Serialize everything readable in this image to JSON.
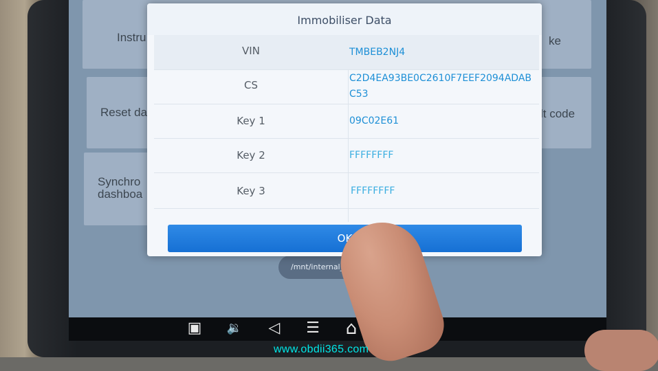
{
  "background_cards": [
    {
      "text": "Instru",
      "name": "bg-card-instrument"
    },
    {
      "text": "Reset da",
      "name": "bg-card-reset"
    },
    {
      "text": "Synchro\ndashboa",
      "name": "bg-card-synchro"
    },
    {
      "text": "ke",
      "name": "bg-card-right-top"
    },
    {
      "text": "lt code",
      "name": "bg-card-fault-code"
    }
  ],
  "path_pill": "/mnt/internal_sd/Sc",
  "dialog": {
    "title": "Immobiliser Data",
    "rows": [
      {
        "label": "VIN",
        "value": "TMBEB2NJ4",
        "value_color": "#1d8fd6"
      },
      {
        "label": "CS",
        "value": "C2D4EA93BE0C2610F7EEF2094ADABC53",
        "value_color": "#1d8fd6"
      },
      {
        "label": "Key 1",
        "value": "09C02E61",
        "value_color": "#1d8fd6"
      },
      {
        "label": "Key 2",
        "value": "FFFFFFFF",
        "value_color": "#3aaee0"
      },
      {
        "label": "Key 3",
        "value": "FFFFFFFF",
        "value_color": "#3aaee0"
      }
    ],
    "ok_label": "OK"
  },
  "nav_icons": [
    {
      "name": "screenshot-icon",
      "glyph": "▣"
    },
    {
      "name": "volume-down-icon",
      "glyph": "🔉"
    },
    {
      "name": "back-icon",
      "glyph": "◁"
    },
    {
      "name": "menu-icon",
      "glyph": "☰"
    },
    {
      "name": "home-icon",
      "glyph": "⌂"
    },
    {
      "name": "volume-up-icon",
      "glyph": "🔊"
    }
  ],
  "watermark": "www.obdii365.com"
}
